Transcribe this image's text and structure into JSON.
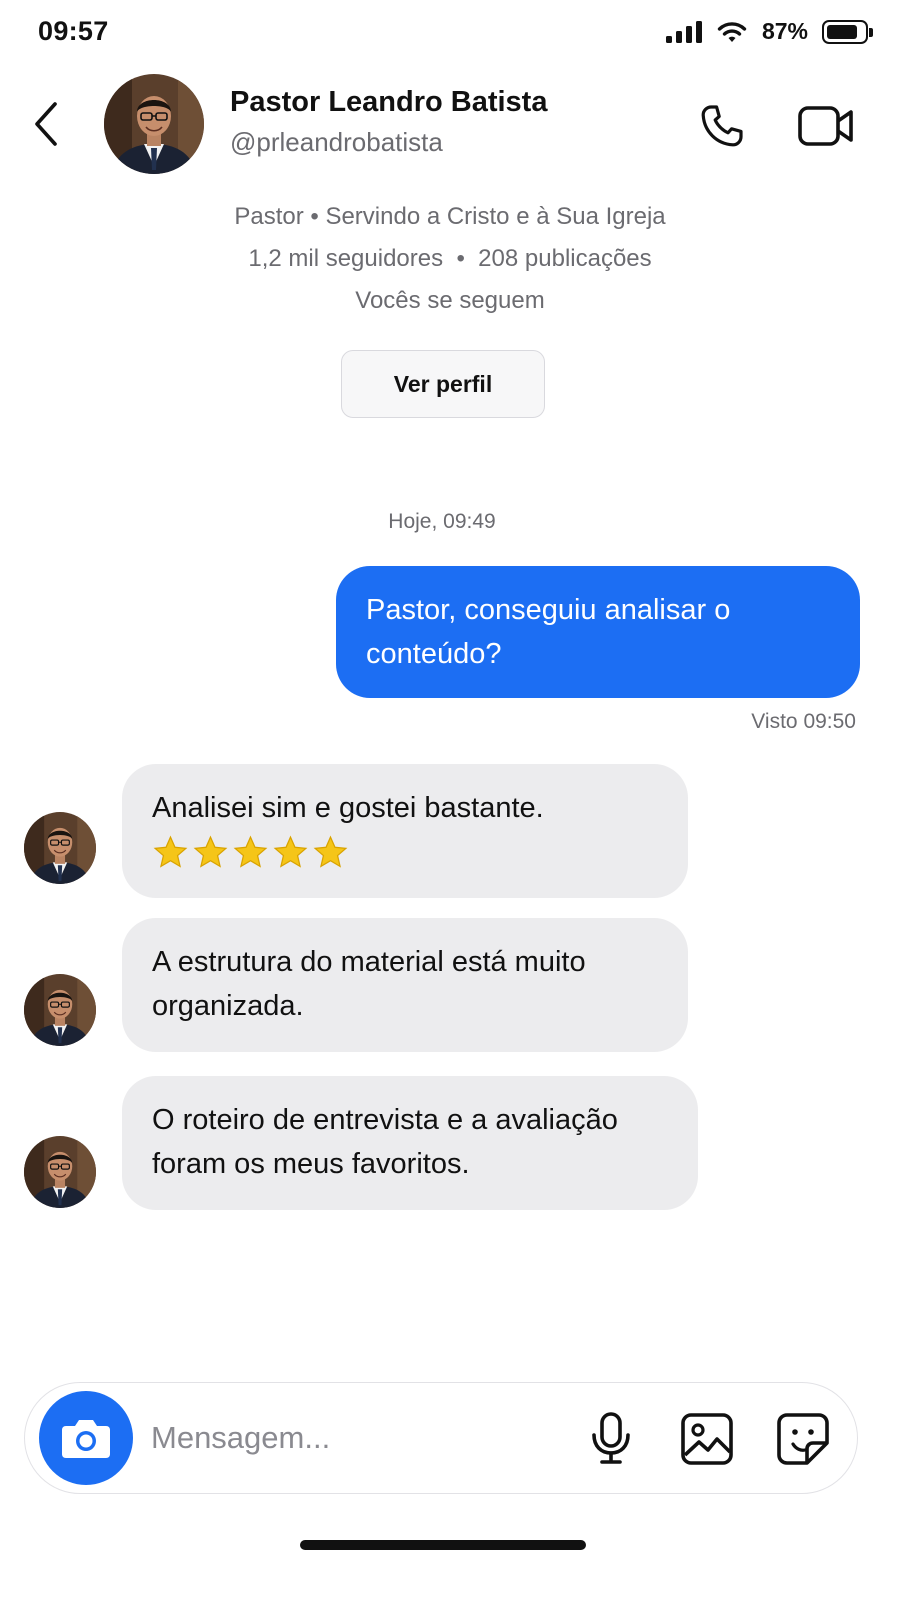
{
  "status_bar": {
    "time": "09:57",
    "battery_percent": "87%",
    "battery_level": 0.87,
    "signal_bars": 4
  },
  "header": {
    "back_icon": "chevron-left-icon",
    "name": "Pastor Leandro Batista",
    "handle": "@prleandrobatista",
    "call_icon": "phone-icon",
    "video_icon": "video-camera-icon"
  },
  "profile": {
    "bio": "Pastor • Servindo a Cristo e à Sua Igreja",
    "stats": "1,2 mil seguidores  •  208 publicações",
    "follow_status": "Vocês se seguem",
    "view_profile_label": "Ver perfil"
  },
  "chat": {
    "timestamp": "Hoje, 09:49",
    "outgoing": [
      {
        "text": "Pastor, conseguiu analisar o conteúdo?",
        "seen": "Visto 09:50"
      }
    ],
    "incoming": [
      {
        "text": "Analisei sim e gostei bastante.",
        "stars": 5
      },
      {
        "text": "A estrutura do material está muito organizada."
      },
      {
        "text": "O roteiro de entrevista e a avaliação foram os meus favoritos."
      }
    ]
  },
  "composer": {
    "placeholder": "Mensagem...",
    "camera_icon": "camera-icon",
    "mic_icon": "microphone-icon",
    "gallery_icon": "image-icon",
    "sticker_icon": "sticker-icon"
  },
  "colors": {
    "accent": "#1c6ef3",
    "incoming_bubble": "#ececee",
    "muted_text": "#6b6b70"
  }
}
